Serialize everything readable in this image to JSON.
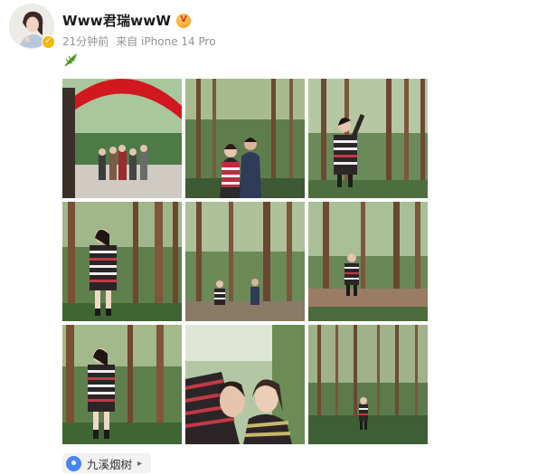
{
  "post": {
    "author": {
      "name": "Www君瑞wwW",
      "verified": true
    },
    "time": "21分钟前",
    "source": "来自 iPhone 14 Pro",
    "text_emoji": "leaf-icon",
    "location": {
      "label": "九溪烟树",
      "arrow": "▸"
    },
    "photos": [
      {
        "scene": "red-arch-lake"
      },
      {
        "scene": "couple-forest"
      },
      {
        "scene": "woman-pointing-forest"
      },
      {
        "scene": "woman-standing-forest"
      },
      {
        "scene": "pair-distant-forest"
      },
      {
        "scene": "woman-steps-forest"
      },
      {
        "scene": "woman-standing-forest-2"
      },
      {
        "scene": "selfie-two-women"
      },
      {
        "scene": "distant-figure-forest"
      }
    ]
  },
  "colors": {
    "accent_blue": "#4585f5",
    "verified_gold": "#f5b800",
    "meta_gray": "#939393"
  }
}
